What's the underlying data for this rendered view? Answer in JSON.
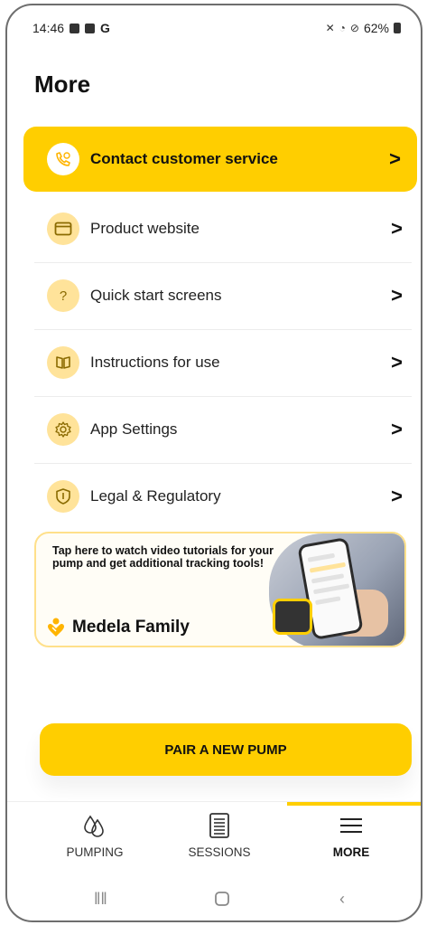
{
  "status_bar": {
    "time": "14:46",
    "carrier_letter": "G",
    "battery": "62%"
  },
  "page": {
    "title": "More"
  },
  "menu": [
    {
      "label": "Contact customer service",
      "icon": "phone-support-icon",
      "highlighted": true
    },
    {
      "label": "Product website",
      "icon": "browser-window-icon"
    },
    {
      "label": "Quick start screens",
      "icon": "question-mark-icon"
    },
    {
      "label": "Instructions for use",
      "icon": "book-icon"
    },
    {
      "label": "App Settings",
      "icon": "gear-icon"
    },
    {
      "label": "Legal & Regulatory",
      "icon": "shield-icon"
    }
  ],
  "chevron": ">",
  "banner": {
    "text": "Tap here to watch video tutorials for your pump and get additional tracking tools!",
    "brand": "Medela Family"
  },
  "pair_button": {
    "label": "PAIR A NEW PUMP"
  },
  "bottom_nav": [
    {
      "label": "PUMPING",
      "icon": "drops-icon"
    },
    {
      "label": "SESSIONS",
      "icon": "list-icon"
    },
    {
      "label": "MORE",
      "icon": "menu-icon",
      "active": true
    }
  ],
  "colors": {
    "accent": "#ffce00",
    "icon_bg": "#ffe39a"
  }
}
